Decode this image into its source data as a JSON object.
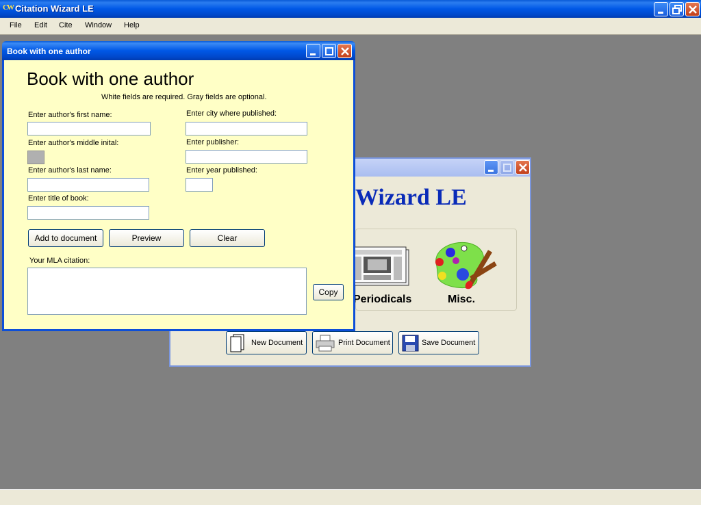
{
  "app": {
    "title": "Citation Wizard LE",
    "icon_text": "CW"
  },
  "menu": [
    "File",
    "Edit",
    "Cite",
    "Window",
    "Help"
  ],
  "main_window": {
    "heading": "Wizard LE",
    "categories": [
      "Periodicals",
      "Misc."
    ],
    "buttons": [
      "New Document",
      "Print Document",
      "Save Document"
    ]
  },
  "form_window": {
    "title": "Book with one author",
    "heading": "Book with one author",
    "note": "White fields are required. Gray fields are optional.",
    "labels": {
      "first_name": "Enter author's first name:",
      "middle_initial": "Enter author's middle inital:",
      "last_name": "Enter author's last name:",
      "book_title": "Enter title of book:",
      "city": "Enter city where published:",
      "publisher": "Enter publisher:",
      "year": "Enter year published:",
      "citation": "Your MLA citation:"
    },
    "buttons": {
      "add": "Add to document",
      "preview": "Preview",
      "clear": "Clear",
      "copy": "Copy"
    }
  },
  "colors": {
    "title_blue": "#0058e6",
    "form_bg": "#ffffc6",
    "panel_bg": "#ece9d8",
    "desktop_gray": "#808080"
  }
}
